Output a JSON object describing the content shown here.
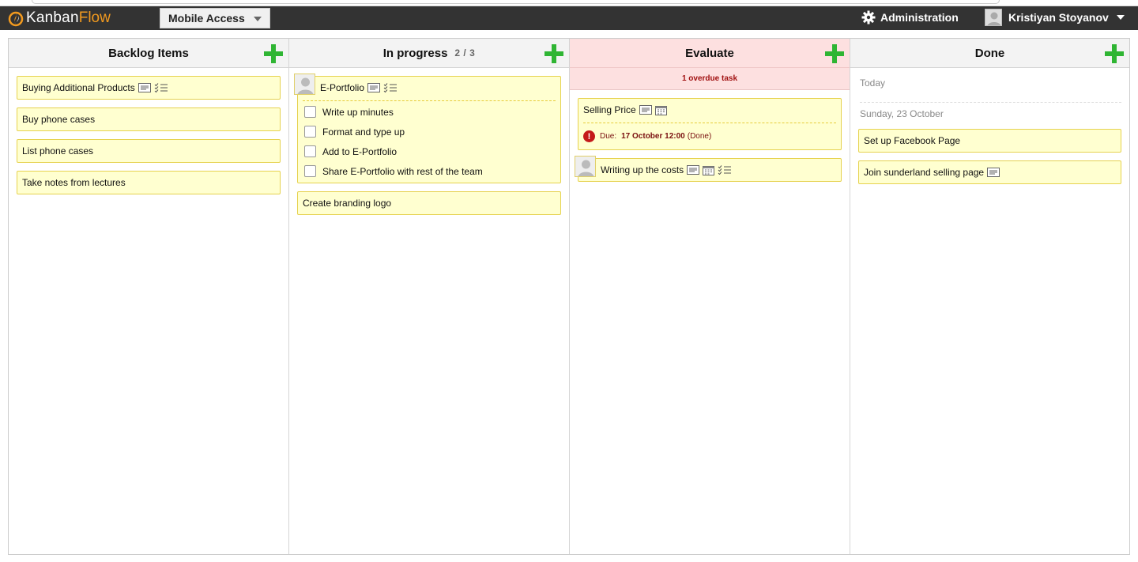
{
  "app": {
    "logo_kanban": "Kanban",
    "logo_flow": "Flow",
    "board_name": "Mobile Access",
    "admin_label": "Administration",
    "user_name": "Kristiyan Stoyanov"
  },
  "columns": [
    {
      "title": "Backlog Items",
      "tasks": [
        {
          "title": "Buying Additional Products",
          "icons": [
            "description-icon",
            "subtasks-icon"
          ]
        },
        {
          "title": "Buy phone cases"
        },
        {
          "title": "List phone cases"
        },
        {
          "title": "Take notes from lectures"
        }
      ]
    },
    {
      "title": "In progress",
      "wip": "2 / 3",
      "tasks": [
        {
          "title": "E-Portfolio",
          "icons": [
            "description-icon",
            "subtasks-icon"
          ],
          "subtasks": [
            "Write up minutes",
            "Format and type up",
            "Add to E-Portfolio",
            "Share E-Portfolio with rest of the team"
          ]
        },
        {
          "title": "Create branding logo"
        }
      ]
    },
    {
      "title": "Evaluate",
      "overdue_note": "1 overdue task",
      "tasks": [
        {
          "title": "Selling Price",
          "icons": [
            "description-icon",
            "calendar-icon"
          ],
          "due_label": "Due:",
          "due_date": "17 October 12:00",
          "due_status": "(Done)"
        },
        {
          "title": "Writing up the costs",
          "icons": [
            "description-icon",
            "calendar-icon",
            "subtasks-icon"
          ]
        }
      ]
    },
    {
      "title": "Done",
      "groups": [
        {
          "label": "Today",
          "tasks": []
        },
        {
          "label": "Sunday, 23 October",
          "tasks": [
            {
              "title": "Set up Facebook Page"
            },
            {
              "title": "Join sunderland selling page",
              "icons": [
                "description-icon"
              ]
            }
          ]
        }
      ]
    }
  ],
  "colors": {
    "topbar": "#333333",
    "accent_orange": "#f29a1f",
    "add_green": "#2fb533",
    "task_bg": "#ffffd0",
    "task_border": "#e6d24f",
    "evaluate_bg": "#fde0e0",
    "overdue_text": "#a01010"
  }
}
